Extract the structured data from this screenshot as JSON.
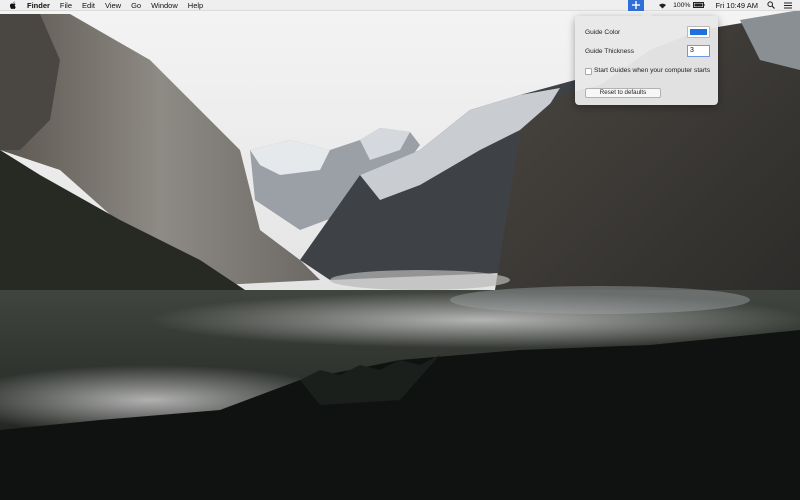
{
  "menubar": {
    "apple_icon": "apple-logo-icon",
    "app_name": "Finder",
    "menus": [
      "File",
      "Edit",
      "View",
      "Go",
      "Window",
      "Help"
    ],
    "status": {
      "guides_icon": "guides-crosshair-icon",
      "wifi_icon": "wifi-icon",
      "battery_percent": "100%",
      "battery_icon": "battery-icon",
      "clock": "Fri 10:49 AM",
      "search_icon": "spotlight-search-icon",
      "list_icon": "notification-center-icon"
    }
  },
  "popover": {
    "guide_color_label": "Guide Color",
    "guide_color_value": "#1f6fe0",
    "guide_thickness_label": "Guide Thickness",
    "guide_thickness_value": "3",
    "start_checkbox_label": "Start Guides when your computer starts",
    "start_checkbox_checked": false,
    "reset_button_label": "Reset to defaults"
  },
  "colors": {
    "menubar_bg": "#eeeeee",
    "status_highlight": "#2f6fd7",
    "popover_bg": "#e8e8e8"
  }
}
